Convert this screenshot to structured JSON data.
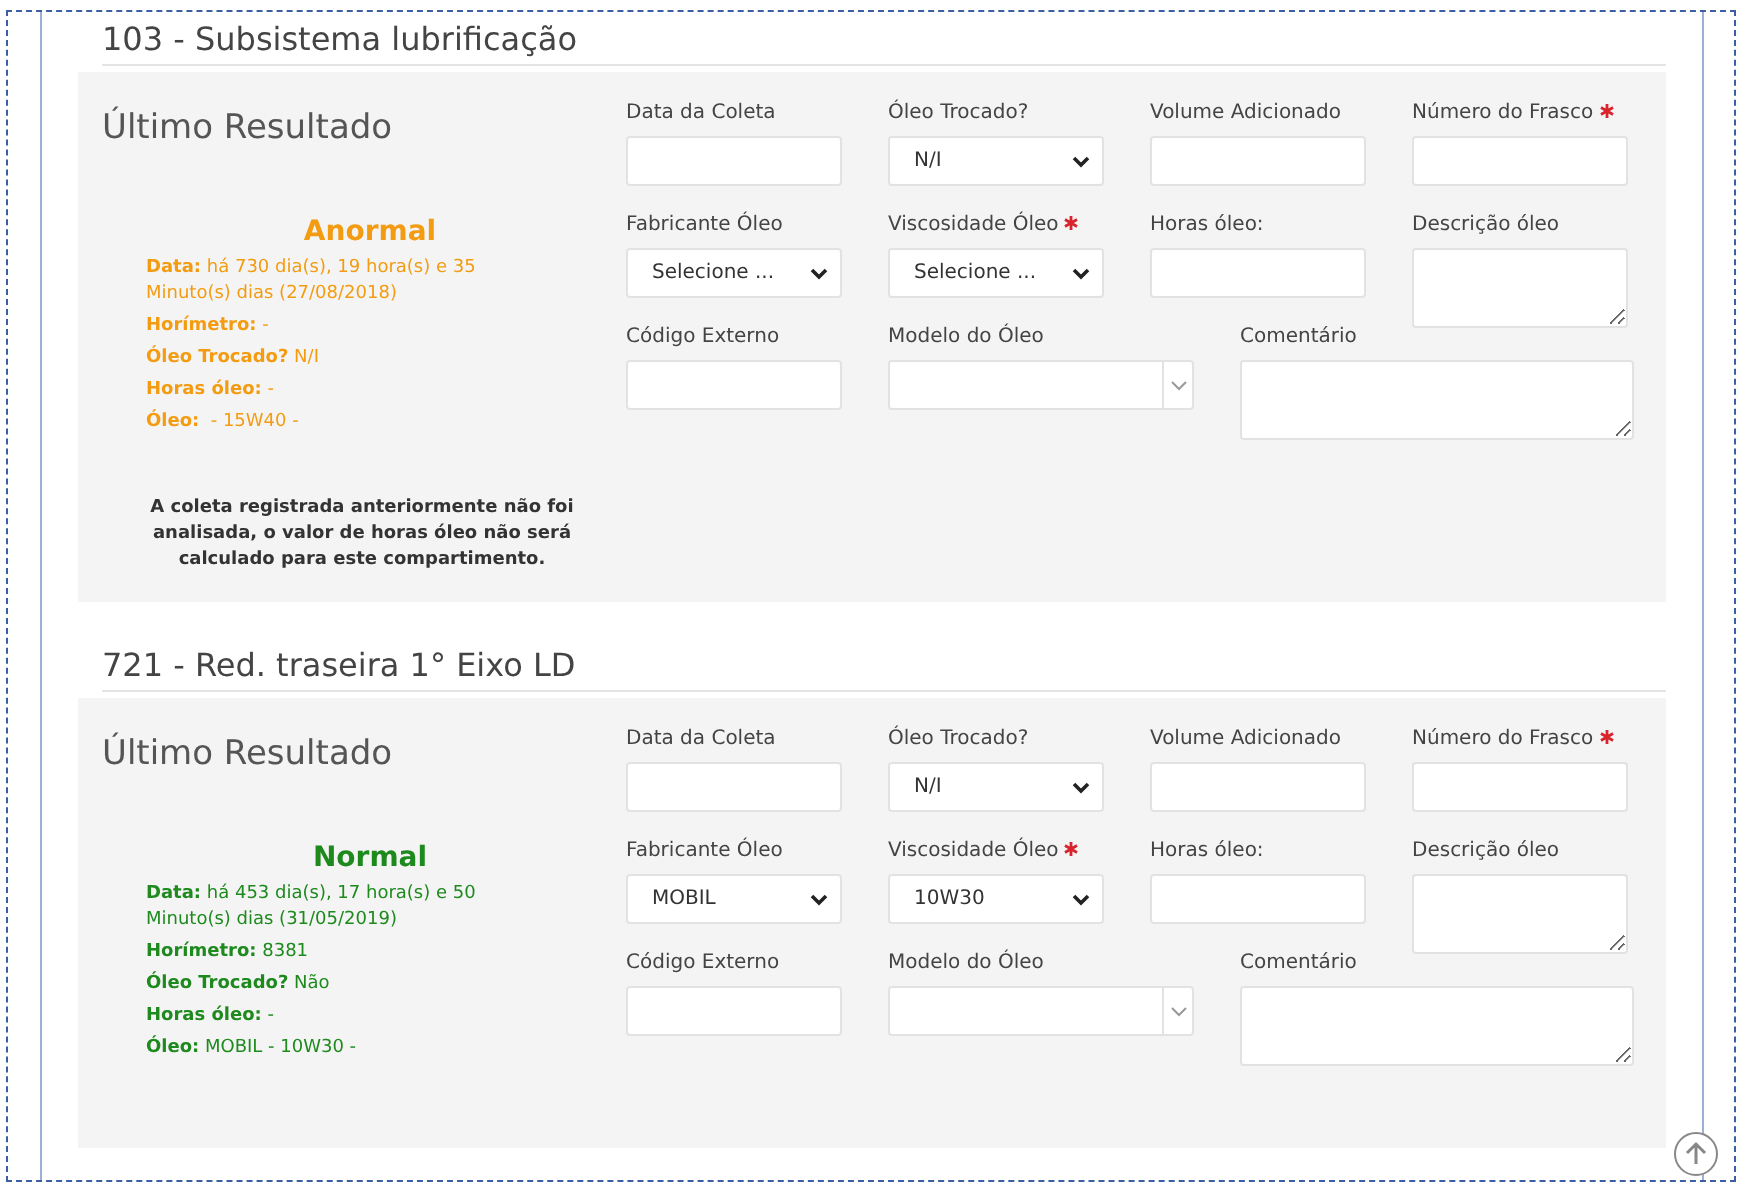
{
  "sections": [
    {
      "title": "103 - Subsistema lubrificação",
      "result": {
        "heading": "Último Resultado",
        "status": "Anormal",
        "color": "#f39c12",
        "lines": [
          "**Data:** há 730 dia(s), 19 hora(s) e 35 Minuto(s) dias (27/08/2018)",
          "**Horímetro:** -",
          "**Óleo Trocado?** N/I",
          "**Horas óleo:** -",
          "**Óleo:**  - 15W40 -"
        ],
        "note": "A coleta registrada anteriormente não foi analisada, o valor de horas óleo não será calculado para este compartimento."
      },
      "fields": [
        {
          "label": "Data da Coleta",
          "kind": "input",
          "required": false
        },
        {
          "label": "Óleo Trocado?",
          "kind": "select",
          "value": "N/I",
          "required": false
        },
        {
          "label": "Volume Adicionado",
          "kind": "input",
          "required": false
        },
        {
          "label": "Número do Frasco",
          "kind": "input",
          "required": true
        },
        {
          "label": "Fabricante Óleo",
          "kind": "select",
          "value": "Selecione ...",
          "required": false
        },
        {
          "label": "Viscosidade Óleo",
          "kind": "select",
          "value": "Selecione ...",
          "required": true
        },
        {
          "label": "Horas óleo:",
          "kind": "input",
          "required": false
        },
        {
          "label": "Descrição óleo",
          "kind": "textarea",
          "required": false
        },
        {
          "label": "Código Externo",
          "kind": "input",
          "required": false
        },
        {
          "label": "Modelo do Óleo",
          "kind": "combo",
          "required": false
        },
        {
          "label": "Comentário",
          "kind": "textarea",
          "required": false
        }
      ]
    },
    {
      "title": "721 - Red. traseira 1° Eixo LD",
      "result": {
        "heading": "Último Resultado",
        "status": "Normal",
        "color": "#1e8a1e",
        "lines": [
          "**Data:** há 453 dia(s), 17 hora(s) e 50 Minuto(s) dias (31/05/2019)",
          "**Horímetro:** 8381",
          "**Óleo Trocado?** Não",
          "**Horas óleo:** -",
          "**Óleo:** MOBIL - 10W30 -"
        ]
      },
      "fields": [
        {
          "label": "Data da Coleta",
          "kind": "input",
          "required": false
        },
        {
          "label": "Óleo Trocado?",
          "kind": "select",
          "value": "N/I",
          "required": false
        },
        {
          "label": "Volume Adicionado",
          "kind": "input",
          "required": false
        },
        {
          "label": "Número do Frasco",
          "kind": "input",
          "required": true
        },
        {
          "label": "Fabricante Óleo",
          "kind": "select",
          "value": "MOBIL",
          "required": false
        },
        {
          "label": "Viscosidade Óleo",
          "kind": "select",
          "value": "10W30",
          "required": true
        },
        {
          "label": "Horas óleo:",
          "kind": "input",
          "required": false
        },
        {
          "label": "Descrição óleo",
          "kind": "textarea",
          "required": false
        },
        {
          "label": "Código Externo",
          "kind": "input",
          "required": false
        },
        {
          "label": "Modelo do Óleo",
          "kind": "combo",
          "required": false
        },
        {
          "label": "Comentário",
          "kind": "textarea",
          "required": false
        }
      ]
    }
  ]
}
